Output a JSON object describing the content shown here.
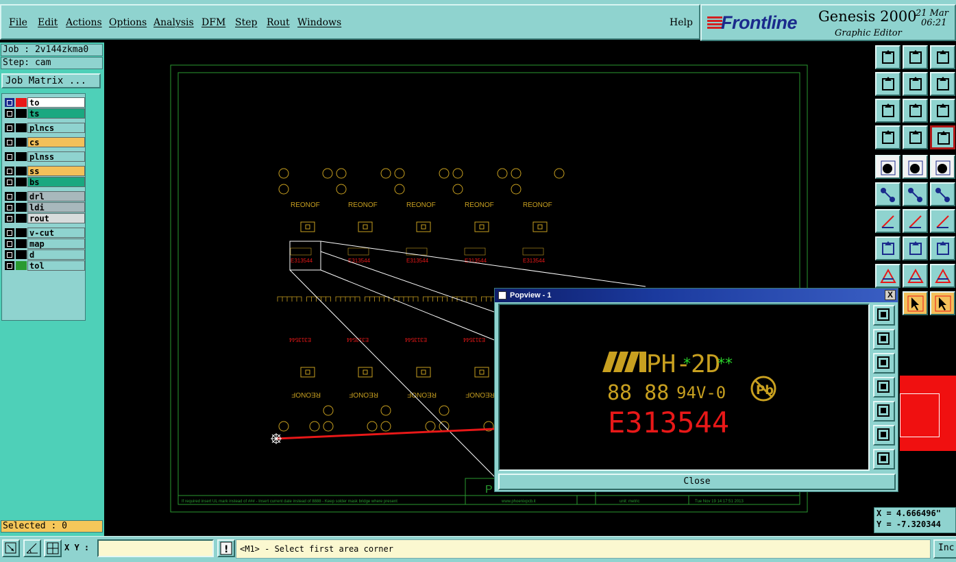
{
  "menu": {
    "items": [
      "File",
      "Edit",
      "Actions",
      "Options",
      "Analysis",
      "DFM",
      "Step",
      "Rout",
      "Windows"
    ],
    "help": "Help"
  },
  "brand": {
    "logo": "Frontline",
    "app_title": "Genesis 2000",
    "subtitle": "Graphic Editor",
    "date": "21 Mar",
    "time": "06:21"
  },
  "job": {
    "job_label": "Job : 2v144zkma0",
    "step_label": "Step: cam",
    "matrix_button": "Job Matrix ..."
  },
  "layers": [
    {
      "name": "to",
      "bg": "#ffffff",
      "swatch": "#e81818",
      "checked": true
    },
    {
      "name": "ts",
      "bg": "#1aa880",
      "swatch": "#000000"
    },
    {
      "name": "plncs",
      "bg": "#8fd3cf",
      "swatch": "#000000"
    },
    {
      "name": "cs",
      "bg": "#f3c05a",
      "swatch": "#000000"
    },
    {
      "name": "plnss",
      "bg": "#8fd3cf",
      "swatch": "#000000"
    },
    {
      "name": "ss",
      "bg": "#f3c05a",
      "swatch": "#000000"
    },
    {
      "name": "bs",
      "bg": "#1aa880",
      "swatch": "#000000"
    },
    {
      "name": "drl",
      "bg": "#a8b8bc",
      "swatch": "#000000"
    },
    {
      "name": "ldi",
      "bg": "#a8b8bc",
      "swatch": "#000000"
    },
    {
      "name": "rout",
      "bg": "#d8dcdc",
      "swatch": "#000000"
    },
    {
      "name": "v-cut",
      "bg": "#8fd3cf",
      "swatch": "#000000"
    },
    {
      "name": "map",
      "bg": "#8fd3cf",
      "swatch": "#000000"
    },
    {
      "name": "d",
      "bg": "#8fd3cf",
      "swatch": "#000000"
    },
    {
      "name": "tol",
      "bg": "#8fd3cf",
      "swatch": "#2a9a30"
    }
  ],
  "selected_label": "Selected : 0",
  "board": {
    "label_top": "REONOF",
    "label_bottom": "REONOF",
    "part_code": "E313544",
    "footer_url": "www.phoenixpcb.it",
    "footer_units": "unit: metric",
    "footer_date": "Tue Nov 19 14:17:51 2013",
    "footer_note": "If required insert UL mark instead of ### - Insert current date instead of 8888 - Keep solder mask bridge where present",
    "corner_text": "P"
  },
  "popview": {
    "title": "Popview - 1",
    "close_x": "X",
    "close_button": "Close",
    "line1": "PH-2D",
    "line2a": "88 88",
    "line2b": "94V-0",
    "pb_mark": "Pb",
    "line3": "E313544"
  },
  "coords": {
    "x": "X = 4.666496\"",
    "y": "Y = -7.320344"
  },
  "bottom": {
    "xy_label": "X Y :",
    "xy_value": "",
    "warn": "!",
    "status": "<M1> - Select first area corner",
    "inc": "Inc"
  },
  "colors": {
    "panel": "#8fd3cf",
    "green_panel": "#4ed0b8",
    "gold": "#c8a020",
    "red": "#e81818"
  }
}
